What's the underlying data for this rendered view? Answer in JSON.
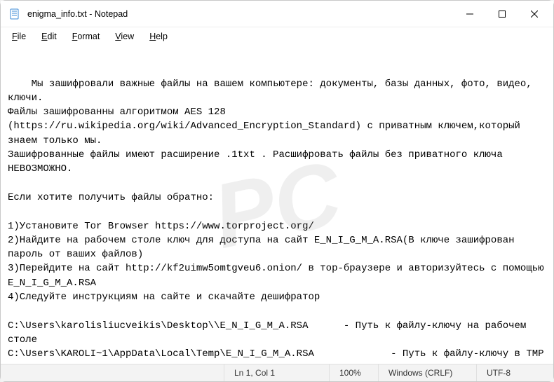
{
  "window": {
    "title": "enigma_info.txt - Notepad"
  },
  "menu": {
    "file": "File",
    "edit": "Edit",
    "format": "Format",
    "view": "View",
    "help": "Help"
  },
  "content": {
    "text": "Мы зашифровали важные файлы на вашем компьютере: документы, базы данных, фото, видео, ключи.\nФайлы зашифрованны алгоритмом AES 128 (https://ru.wikipedia.org/wiki/Advanced_Encryption_Standard) с приватным ключем,который знаем только мы.\nЗашифрованные файлы имеют расширение .1txt . Расшифровать файлы без приватного ключа НЕВОЗМОЖНО.\n\nЕсли хотите получить файлы обратно:\n\n1)Установите Tor Browser https://www.torproject.org/\n2)Найдите на рабочем столе ключ для доступа на сайт E_N_I_G_M_A.RSA(В ключе зашифрован пароль от ваших файлов)\n3)Перейдите на сайт http://kf2uimw5omtgveu6.onion/ в тор-браузере и авторизуйтесь с помощью E_N_I_G_M_A.RSA\n4)Следуйте инструкциям на сайте и скачайте дешифратор\n\nC:\\Users\\karolisliucveikis\\Desktop\\\\E_N_I_G_M_A.RSA      - Путь к файлу-ключу на рабочем столе\nC:\\Users\\KAROLI~1\\AppData\\Local\\Temp\\E_N_I_G_M_A.RSA             - Путь к файлу-ключу в TMP папке"
  },
  "statusbar": {
    "position": "Ln 1, Col 1",
    "zoom": "100%",
    "lineending": "Windows (CRLF)",
    "encoding": "UTF-8"
  },
  "watermark": "PC"
}
